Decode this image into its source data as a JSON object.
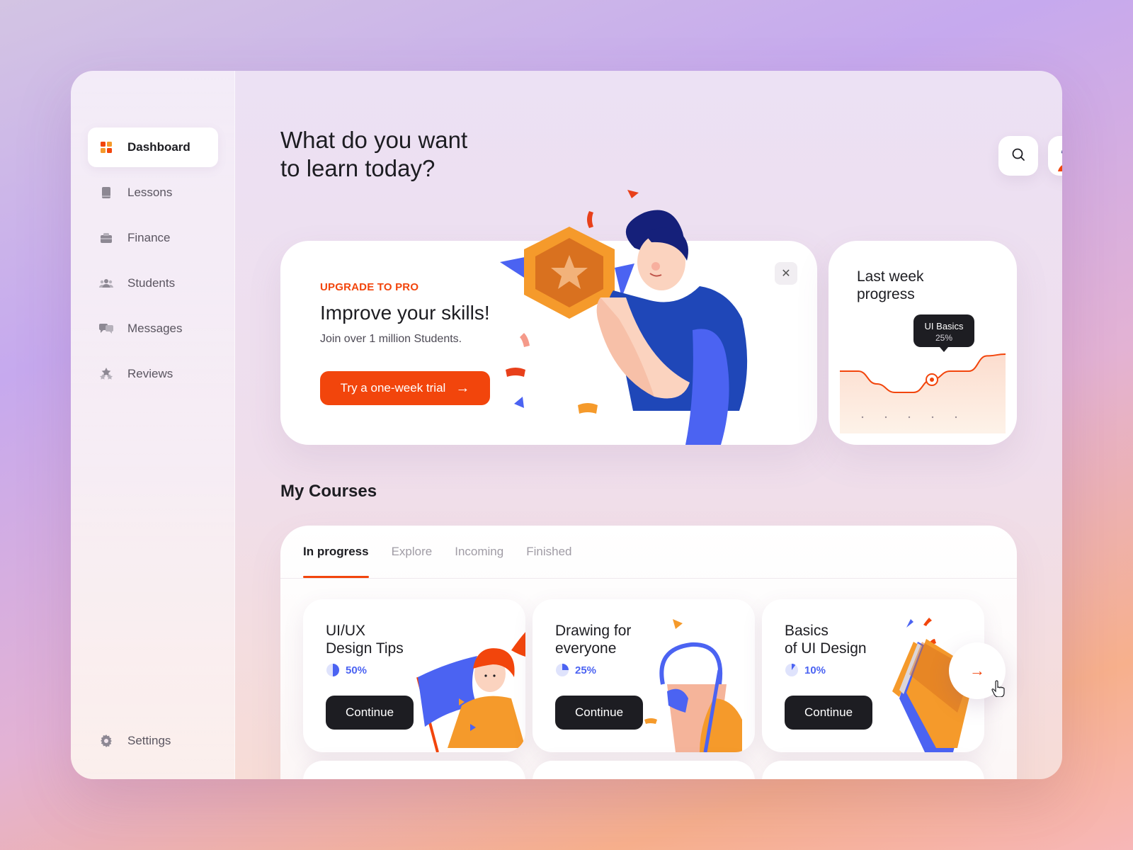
{
  "sidebar": {
    "items": [
      {
        "label": "Dashboard",
        "icon": "dashboard-icon",
        "active": true
      },
      {
        "label": "Lessons",
        "icon": "book-icon"
      },
      {
        "label": "Finance",
        "icon": "wallet-icon"
      },
      {
        "label": "Students",
        "icon": "people-icon"
      },
      {
        "label": "Messages",
        "icon": "chat-icon"
      },
      {
        "label": "Reviews",
        "icon": "stars-icon"
      }
    ],
    "settings_label": "Settings"
  },
  "header": {
    "title_line1": "What do you want",
    "title_line2": "to learn today?"
  },
  "promo": {
    "tag": "UPGRADE TO PRO",
    "title": "Improve your skills!",
    "subtitle": "Join over 1 million Students.",
    "button_label": "Try a one-week trial",
    "close": "✕"
  },
  "progress": {
    "title": "Last week progress",
    "tooltip_title": "UI Basics",
    "tooltip_value": "25%",
    "chart_data": {
      "type": "line",
      "series": [
        {
          "values": [
            60,
            60,
            45,
            35,
            35,
            50,
            60,
            60,
            78,
            80
          ]
        }
      ],
      "highlight_index": 5,
      "highlight_label": "UI Basics",
      "highlight_value": "25%",
      "ylim": [
        0,
        100
      ],
      "grid": false
    }
  },
  "courses": {
    "section_title": "My Courses",
    "tabs": [
      "In progress",
      "Explore",
      "Incoming",
      "Finished"
    ],
    "active_tab": 0,
    "items": [
      {
        "title_line1": "UI/UX",
        "title_line2": "Design Tips",
        "progress": "50%",
        "fraction": 0.5,
        "button": "Continue"
      },
      {
        "title_line1": "Drawing for",
        "title_line2": "everyone",
        "progress": "25%",
        "fraction": 0.25,
        "button": "Continue"
      },
      {
        "title_line1": "Basics",
        "title_line2": "of UI Design",
        "progress": "10%",
        "fraction": 0.1,
        "button": "Continue"
      }
    ]
  },
  "colors": {
    "accent": "#f2450c",
    "blue": "#4b63f2",
    "dark": "#1d1d22",
    "orange": "#f59a2b"
  }
}
